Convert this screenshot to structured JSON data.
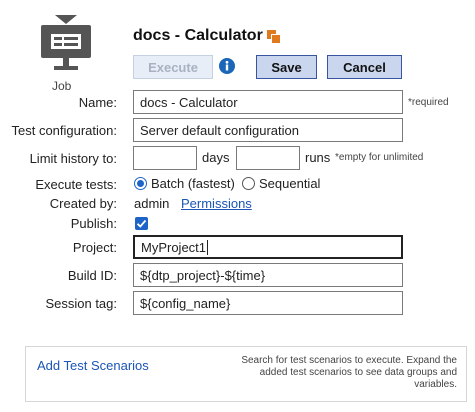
{
  "header": {
    "job_label": "Job",
    "title": "docs - Calculator",
    "job_icon": "monitor-job-icon",
    "copy_icon": "copy-icon",
    "info_icon": "info-icon"
  },
  "toolbar": {
    "execute_label": "Execute",
    "save_label": "Save",
    "cancel_label": "Cancel"
  },
  "form": {
    "name_label": "Name:",
    "name_value": "docs - Calculator",
    "name_hint": "*required",
    "test_config_label": "Test configuration:",
    "test_config_value": "Server default configuration",
    "limit_history_label": "Limit history to:",
    "days_value": "",
    "days_label": "days",
    "runs_value": "",
    "runs_label": "runs",
    "limit_hint": "*empty for unlimited",
    "execute_tests_label": "Execute tests:",
    "batch_label": "Batch (fastest)",
    "sequential_label": "Sequential",
    "batch_selected": true,
    "created_by_label": "Created by:",
    "created_by_value": "admin",
    "permissions_link": "Permissions",
    "publish_label": "Publish:",
    "publish_checked": true,
    "project_label": "Project:",
    "project_value": "MyProject1",
    "build_id_label": "Build ID:",
    "build_id_value": "${dtp_project}-${time}",
    "session_tag_label": "Session tag:",
    "session_tag_value": "${config_name}"
  },
  "scenarios": {
    "add_link": "Add Test Scenarios",
    "hint": "Search for test scenarios to execute. Expand the added test scenarios to see data groups and variables."
  },
  "colors": {
    "accent": "#1d63c8",
    "button_bg": "#c9d6ee",
    "button_border": "#3a55a0",
    "link": "#1a55b5",
    "copy_icon": "#e07a1f"
  }
}
